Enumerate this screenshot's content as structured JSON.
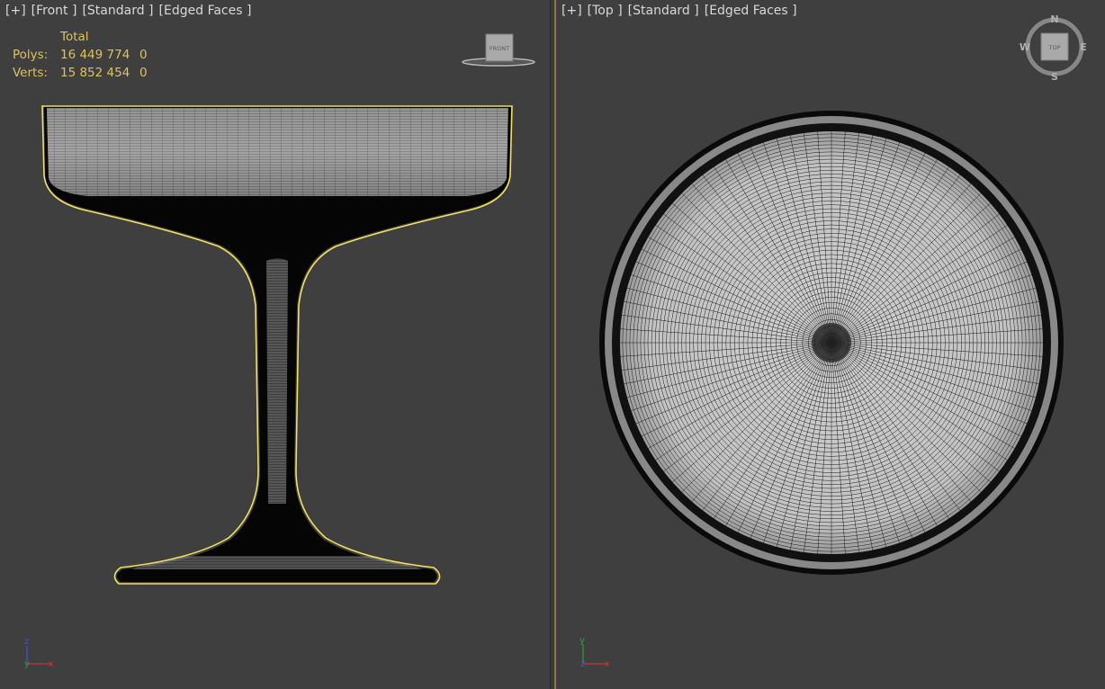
{
  "front_viewport": {
    "label_plus": "[+]",
    "label_view": "[Front ]",
    "label_shading": "[Standard ]",
    "label_edges": "[Edged Faces ]",
    "viewcube_label": "FRONT",
    "stats": {
      "header": "Total",
      "polys_label": "Polys:",
      "polys_total": "16 449 774",
      "polys_selected": "0",
      "verts_label": "Verts:",
      "verts_total": "15 852 454",
      "verts_selected": "0"
    },
    "axis": {
      "up": "z",
      "right": "x",
      "origin": "y"
    }
  },
  "top_viewport": {
    "label_plus": "[+]",
    "label_view": "[Top ]",
    "label_shading": "[Standard ]",
    "label_edges": "[Edged Faces ]",
    "viewcube_label": "TOP",
    "compass": {
      "n": "N",
      "s": "S",
      "e": "E",
      "w": "W"
    },
    "axis": {
      "up": "y",
      "right": "x",
      "origin": "z"
    }
  },
  "colors": {
    "viewport_bg": "#3f3f3f",
    "selection_outline": "#f0e060",
    "stats_text": "#e0c060",
    "active_border": "#8a7a3a"
  }
}
